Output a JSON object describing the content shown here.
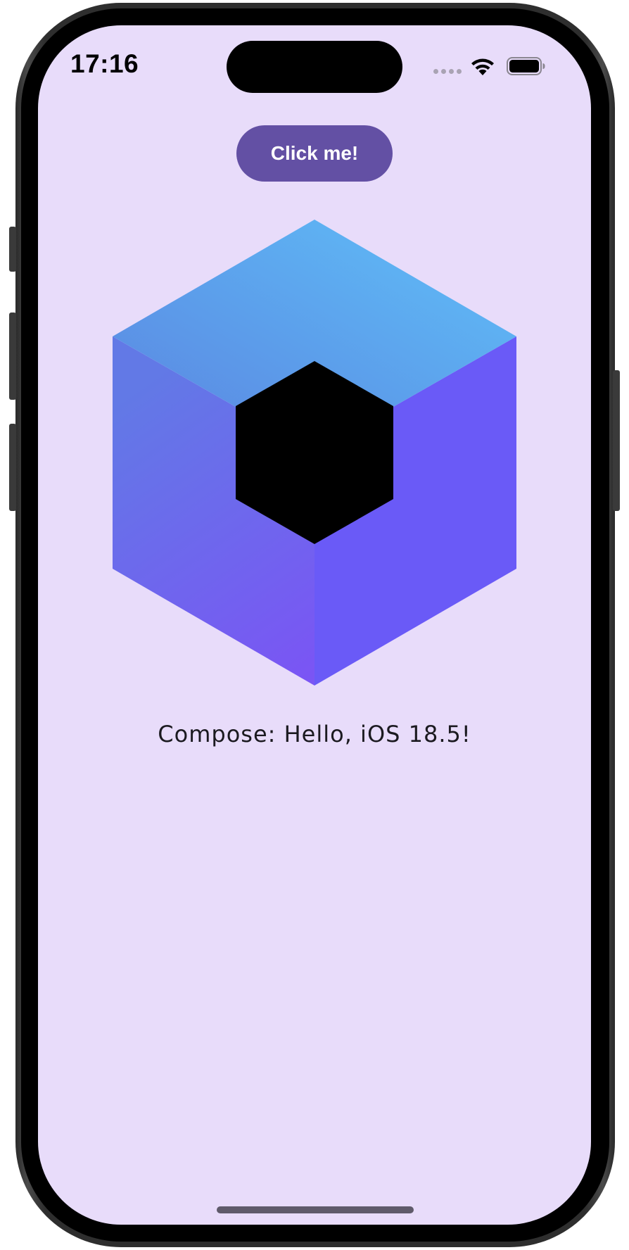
{
  "status_bar": {
    "time": "17:16",
    "icons": [
      "cellular-icon",
      "wifi-icon",
      "battery-icon"
    ]
  },
  "main": {
    "button_label": "Click me!",
    "greeting": "Compose: Hello, iOS 18.5!",
    "logo_icon": "compose-multiplatform-logo"
  },
  "colors": {
    "background": "#e8dcfa",
    "button": "#6350a4",
    "logo_top": "#5eb4f5",
    "logo_right": "#6a5af7",
    "logo_left": "#6f5df2",
    "logo_center": "#000000"
  }
}
